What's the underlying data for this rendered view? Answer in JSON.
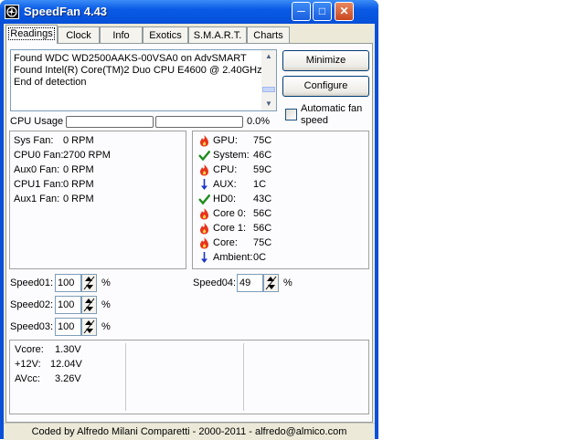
{
  "window": {
    "title": "SpeedFan 4.43",
    "minimize_glyph": "─",
    "maximize_glyph": "□",
    "close_glyph": "✕"
  },
  "tabs": [
    {
      "label": "Readings"
    },
    {
      "label": "Clock"
    },
    {
      "label": "Info"
    },
    {
      "label": "Exotics"
    },
    {
      "label": "S.M.A.R.T."
    },
    {
      "label": "Charts"
    }
  ],
  "log": {
    "lines": [
      "Found WDC WD2500AAKS-00VSA0 on AdvSMART",
      "Found Intel(R) Core(TM)2 Duo CPU E4600 @ 2.40GHz",
      "End of detection"
    ],
    "scroll_position": 0.8
  },
  "buttons": {
    "minimize": "Minimize",
    "configure": "Configure"
  },
  "auto_fan": {
    "label_line1": "Automatic fan",
    "label_line2": "speed",
    "checked": false
  },
  "cpu_usage": {
    "label": "CPU Usage",
    "value": "0.0%",
    "core_loads": [
      0,
      0
    ]
  },
  "fans": [
    {
      "name": "Sys Fan:",
      "value": "0 RPM"
    },
    {
      "name": "CPU0 Fan:",
      "value": "2700 RPM"
    },
    {
      "name": "Aux0 Fan:",
      "value": "0 RPM"
    },
    {
      "name": "CPU1 Fan:",
      "value": "0 RPM"
    },
    {
      "name": "Aux1 Fan:",
      "value": "0 RPM"
    }
  ],
  "temps": [
    {
      "name": "GPU:",
      "value": "75C",
      "icon": "flame-icon"
    },
    {
      "name": "System:",
      "value": "46C",
      "icon": "check-icon"
    },
    {
      "name": "CPU:",
      "value": "59C",
      "icon": "flame-icon"
    },
    {
      "name": "AUX:",
      "value": "1C",
      "icon": "arrow-down-icon"
    },
    {
      "name": "HD0:",
      "value": "43C",
      "icon": "check-icon"
    },
    {
      "name": "Core 0:",
      "value": "56C",
      "icon": "flame-icon"
    },
    {
      "name": "Core 1:",
      "value": "56C",
      "icon": "flame-icon"
    },
    {
      "name": "Core:",
      "value": "75C",
      "icon": "flame-icon"
    },
    {
      "name": "Ambient:",
      "value": "0C",
      "icon": "arrow-down-icon"
    }
  ],
  "speeds": [
    {
      "label": "Speed01:",
      "value": "100",
      "unit": "%"
    },
    {
      "label": "Speed02:",
      "value": "100",
      "unit": "%"
    },
    {
      "label": "Speed03:",
      "value": "100",
      "unit": "%"
    },
    {
      "label": "Speed04:",
      "value": "49",
      "unit": "%"
    }
  ],
  "voltages": [
    {
      "name": "Vcore:",
      "value": "1.30V"
    },
    {
      "name": "+12V:",
      "value": "12.04V"
    },
    {
      "name": "AVcc:",
      "value": "3.26V"
    }
  ],
  "status_bar": "Coded by Alfredo Milani Comparetti - 2000-2011 - alfredo@almico.com",
  "colors": {
    "flame": "#e8341c",
    "check": "#1c8c1c",
    "arrow": "#1c34c8",
    "title_bar": "#0a5ae6"
  }
}
